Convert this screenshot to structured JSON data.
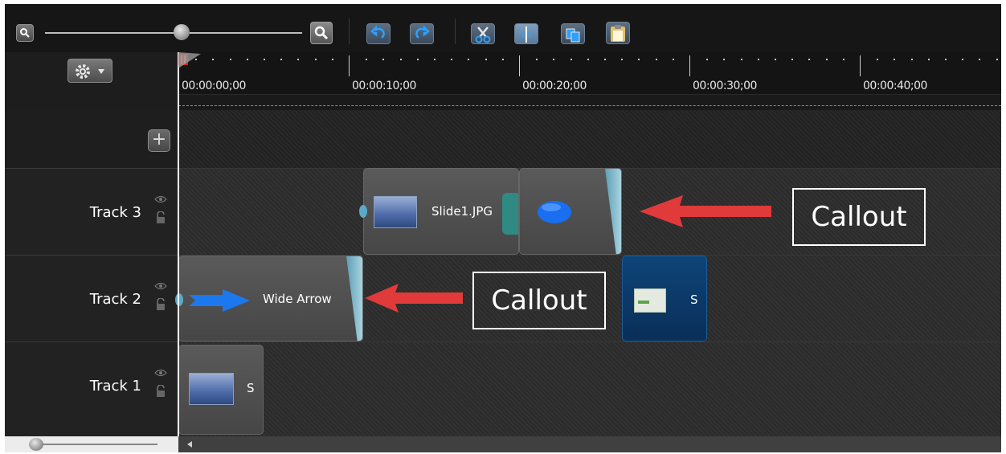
{
  "toolbar": {
    "zoom_level": 0.6,
    "buttons": [
      {
        "id": "zoom-out",
        "icon": "zoom-out-icon"
      },
      {
        "id": "zoom-in",
        "icon": "zoom-in-icon"
      },
      {
        "id": "undo",
        "icon": "undo-icon"
      },
      {
        "id": "redo",
        "icon": "redo-icon"
      },
      {
        "id": "cut",
        "icon": "cut-icon"
      },
      {
        "id": "split",
        "icon": "split-icon"
      },
      {
        "id": "copy",
        "icon": "copy-icon"
      },
      {
        "id": "paste",
        "icon": "paste-icon"
      }
    ]
  },
  "timeline": {
    "time_marks": [
      "00:00:00;00",
      "00:00:10;00",
      "00:00:20;00",
      "00:00:30;00",
      "00:00:40;00"
    ],
    "playhead_time": "00:00:00;00",
    "add_track_label": "+"
  },
  "tracks": [
    {
      "name": "Track 3"
    },
    {
      "name": "Track 2"
    },
    {
      "name": "Track 1"
    }
  ],
  "clips": {
    "slide1": "Slide1.JPG",
    "wide_arrow": "Wide Arrow",
    "track2_media": "S",
    "track1_media": "S"
  },
  "annotations": {
    "callout_1": "Callout",
    "callout_2": "Callout"
  },
  "colors": {
    "background": "#1a1a1a",
    "arrow_red": "#e03a3a",
    "clip_tail": "#8cc4d6",
    "playhead_marker": "#d81f1f",
    "media_clip_blue": "#0d3a6a"
  }
}
